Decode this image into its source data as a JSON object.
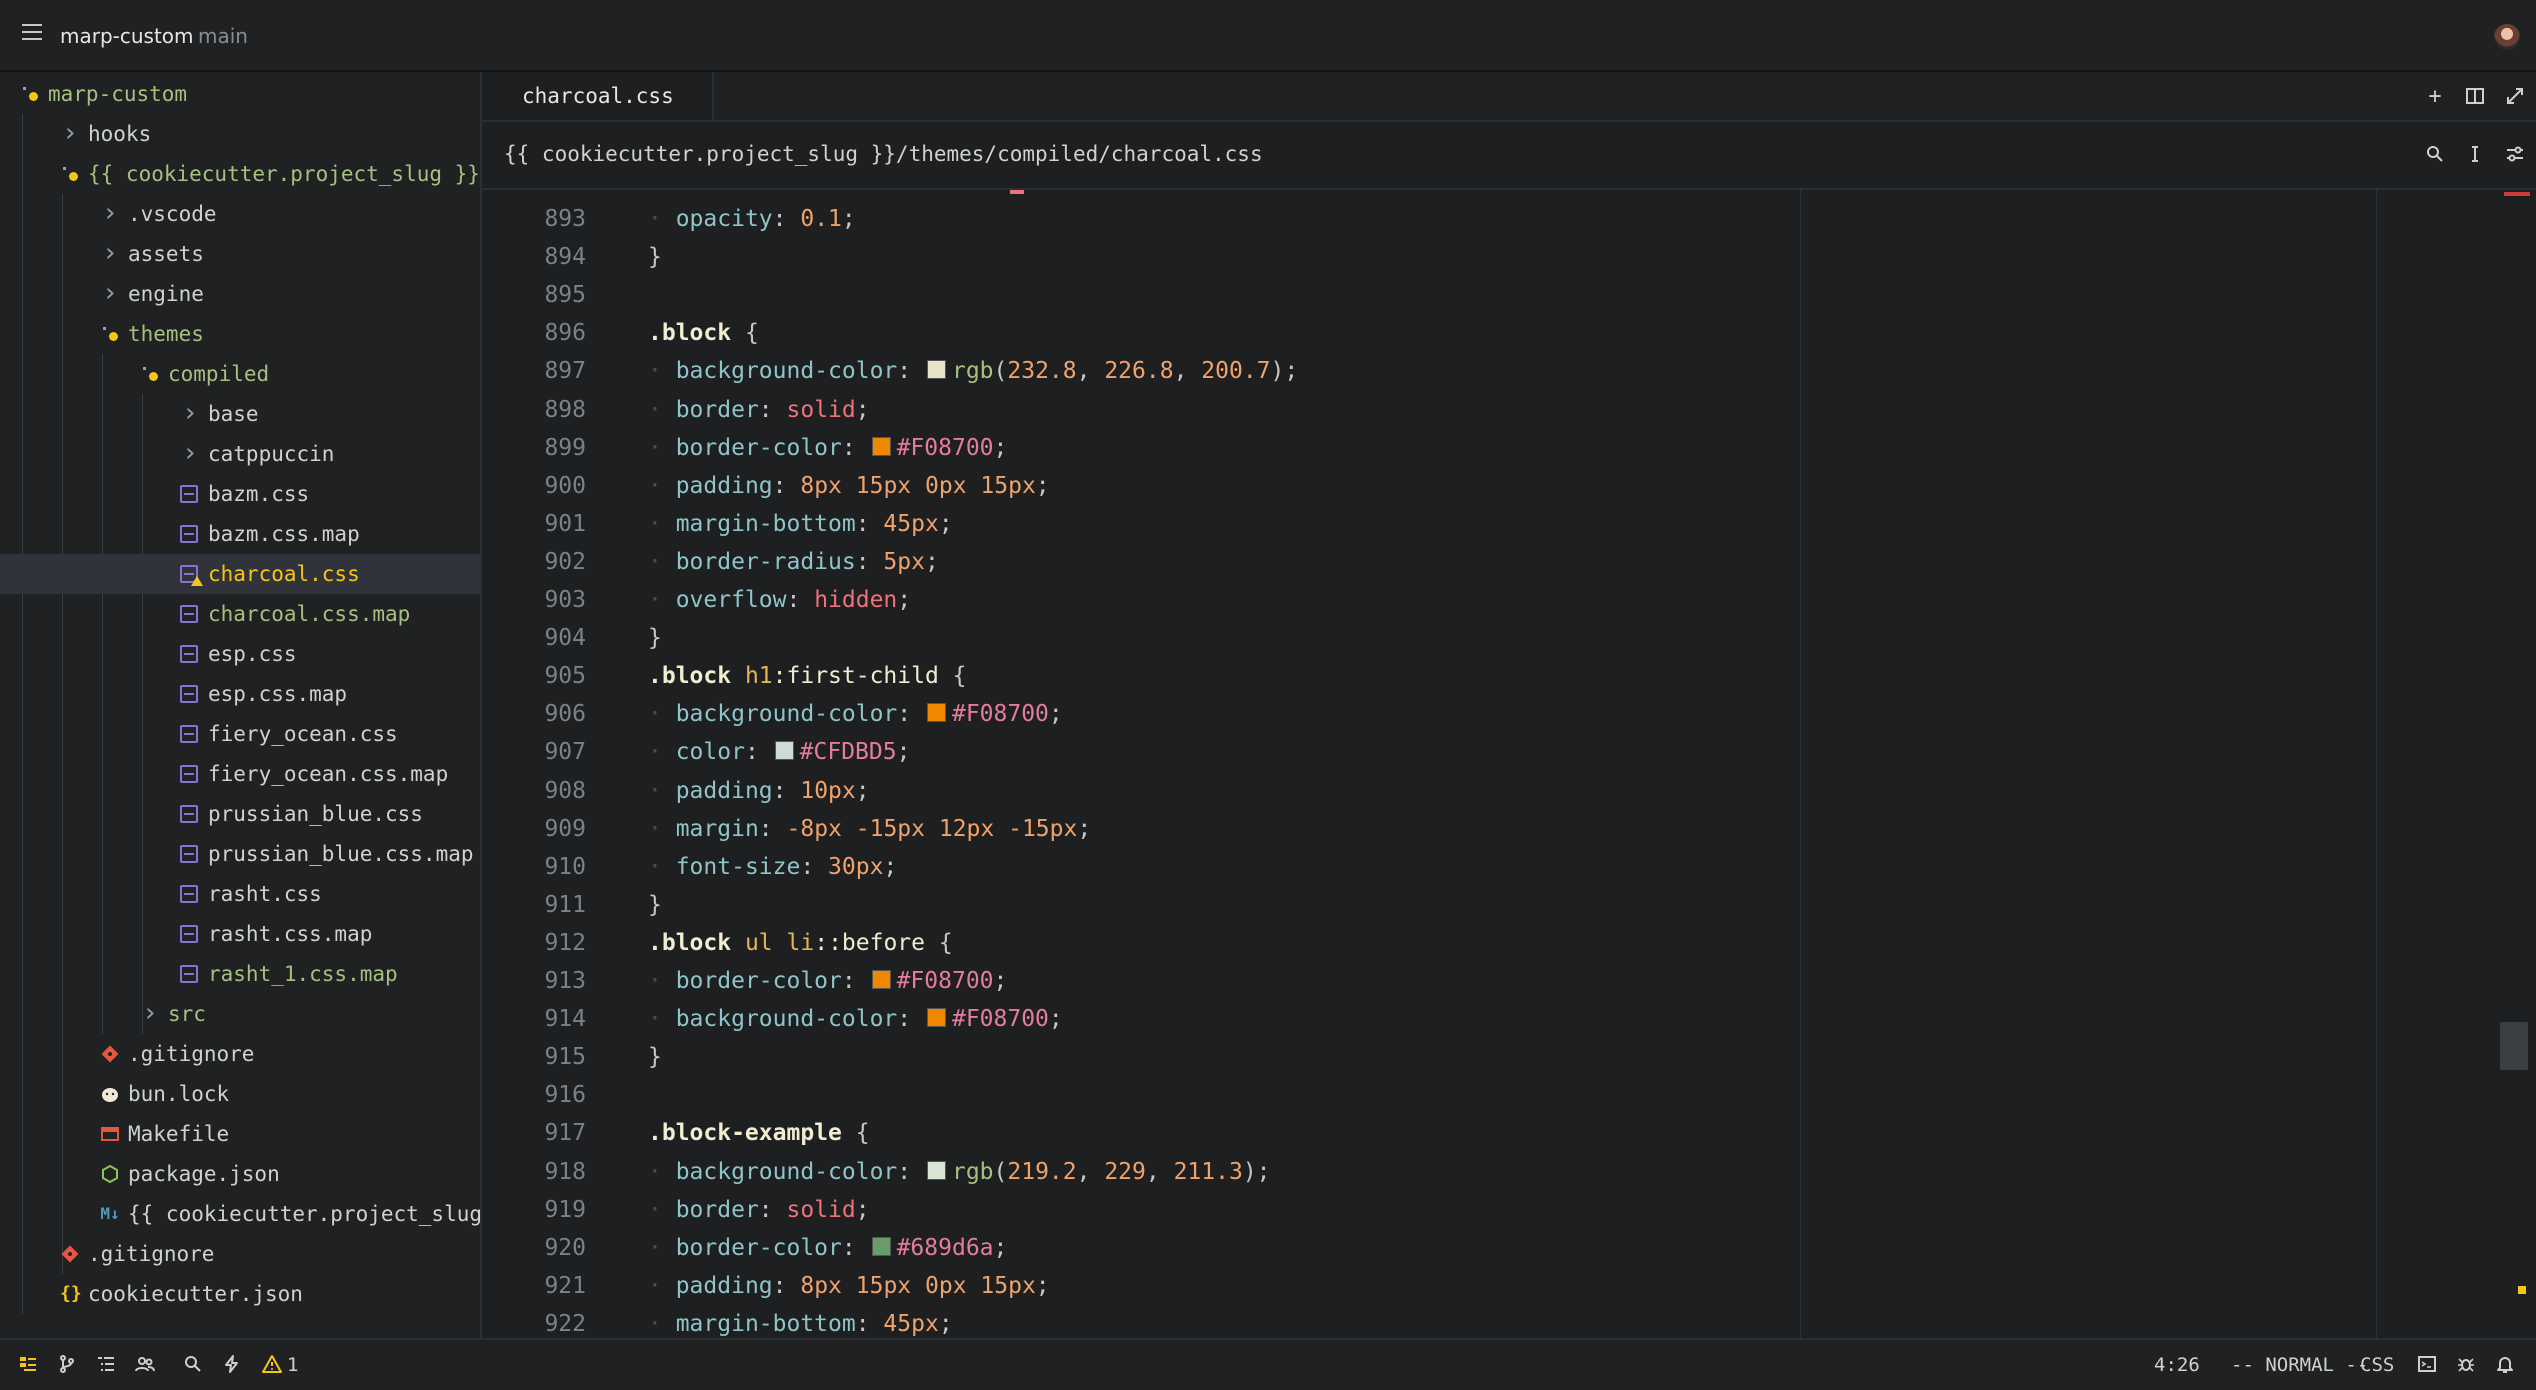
{
  "titlebar": {
    "project": "marp-custom",
    "branch": "main"
  },
  "sidebar": {
    "items": [
      {
        "label": "marp-custom",
        "kind": "folder-open-modified",
        "depth": 0,
        "color": "#a7c080"
      },
      {
        "label": "hooks",
        "kind": "folder",
        "depth": 1,
        "color": "#cfd1d2"
      },
      {
        "label": "{{ cookiecutter.project_slug }}",
        "kind": "folder-open-modified",
        "depth": 1,
        "color": "#a7c080"
      },
      {
        "label": ".vscode",
        "kind": "folder",
        "depth": 2,
        "color": "#cfd1d2"
      },
      {
        "label": "assets",
        "kind": "folder",
        "depth": 2,
        "color": "#cfd1d2"
      },
      {
        "label": "engine",
        "kind": "folder",
        "depth": 2,
        "color": "#cfd1d2"
      },
      {
        "label": "themes",
        "kind": "folder-open-modified",
        "depth": 2,
        "color": "#a7c080"
      },
      {
        "label": "compiled",
        "kind": "folder-open-modified",
        "depth": 3,
        "color": "#a7c080"
      },
      {
        "label": "base",
        "kind": "folder",
        "depth": 4,
        "color": "#cfd1d2"
      },
      {
        "label": "catppuccin",
        "kind": "folder",
        "depth": 4,
        "color": "#cfd1d2"
      },
      {
        "label": "bazm.css",
        "kind": "css",
        "depth": 4,
        "color": "#cfd1d2"
      },
      {
        "label": "bazm.css.map",
        "kind": "css",
        "depth": 4,
        "color": "#cfd1d2"
      },
      {
        "label": "charcoal.css",
        "kind": "css-warn",
        "depth": 4,
        "color": "#f5c518",
        "selected": true
      },
      {
        "label": "charcoal.css.map",
        "kind": "css",
        "depth": 4,
        "color": "#a7c080"
      },
      {
        "label": "esp.css",
        "kind": "css",
        "depth": 4,
        "color": "#cfd1d2"
      },
      {
        "label": "esp.css.map",
        "kind": "css",
        "depth": 4,
        "color": "#cfd1d2"
      },
      {
        "label": "fiery_ocean.css",
        "kind": "css",
        "depth": 4,
        "color": "#cfd1d2"
      },
      {
        "label": "fiery_ocean.css.map",
        "kind": "css",
        "depth": 4,
        "color": "#cfd1d2"
      },
      {
        "label": "prussian_blue.css",
        "kind": "css",
        "depth": 4,
        "color": "#cfd1d2"
      },
      {
        "label": "prussian_blue.css.map",
        "kind": "css",
        "depth": 4,
        "color": "#cfd1d2"
      },
      {
        "label": "rasht.css",
        "kind": "css",
        "depth": 4,
        "color": "#cfd1d2"
      },
      {
        "label": "rasht.css.map",
        "kind": "css",
        "depth": 4,
        "color": "#cfd1d2"
      },
      {
        "label": "rasht_1.css.map",
        "kind": "css",
        "depth": 4,
        "color": "#a7c080"
      },
      {
        "label": "src",
        "kind": "folder",
        "depth": 3,
        "color": "#a7c080"
      },
      {
        "label": ".gitignore",
        "kind": "git",
        "depth": 2,
        "color": "#cfd1d2"
      },
      {
        "label": "bun.lock",
        "kind": "bun",
        "depth": 2,
        "color": "#cfd1d2"
      },
      {
        "label": "Makefile",
        "kind": "make",
        "depth": 2,
        "color": "#cfd1d2"
      },
      {
        "label": "package.json",
        "kind": "node",
        "depth": 2,
        "color": "#cfd1d2"
      },
      {
        "label": "{{ cookiecutter.project_slug",
        "kind": "md",
        "depth": 2,
        "color": "#cfd1d2"
      },
      {
        "label": ".gitignore",
        "kind": "git",
        "depth": 1,
        "color": "#cfd1d2"
      },
      {
        "label": "cookiecutter.json",
        "kind": "json",
        "depth": 1,
        "color": "#cfd1d2"
      }
    ]
  },
  "editor": {
    "tab_label": "charcoal.css",
    "breadcrumb": "{{ cookiecutter.project_slug }}/themes/compiled/charcoal.css",
    "lines": [
      {
        "n": "893",
        "tokens": [
          [
            "i",
            "  "
          ],
          [
            "prop",
            "opacity"
          ],
          [
            "punc",
            ": "
          ],
          [
            "num",
            "0.1"
          ],
          [
            "punc",
            ";"
          ]
        ]
      },
      {
        "n": "894",
        "tokens": [
          [
            "punc",
            "}"
          ]
        ]
      },
      {
        "n": "895",
        "tokens": []
      },
      {
        "n": "896",
        "tokens": [
          [
            "sel",
            ".block"
          ],
          [
            "punc",
            " {"
          ]
        ]
      },
      {
        "n": "897",
        "tokens": [
          [
            "i",
            "  "
          ],
          [
            "prop",
            "background-color"
          ],
          [
            "punc",
            ": "
          ],
          [
            "sw",
            "#e8e2c8"
          ],
          [
            "fn",
            "rgb"
          ],
          [
            "punc",
            "("
          ],
          [
            "num",
            "232.8"
          ],
          [
            "punc",
            ", "
          ],
          [
            "num",
            "226.8"
          ],
          [
            "punc",
            ", "
          ],
          [
            "num",
            "200.7"
          ],
          [
            "punc",
            ");"
          ]
        ]
      },
      {
        "n": "898",
        "tokens": [
          [
            "i",
            "  "
          ],
          [
            "prop",
            "border"
          ],
          [
            "punc",
            ": "
          ],
          [
            "val",
            "solid"
          ],
          [
            "punc",
            ";"
          ]
        ]
      },
      {
        "n": "899",
        "tokens": [
          [
            "i",
            "  "
          ],
          [
            "prop",
            "border-color"
          ],
          [
            "punc",
            ": "
          ],
          [
            "sw",
            "#F08700"
          ],
          [
            "hex",
            "#F08700"
          ],
          [
            "punc",
            ";"
          ]
        ]
      },
      {
        "n": "900",
        "tokens": [
          [
            "i",
            "  "
          ],
          [
            "prop",
            "padding"
          ],
          [
            "punc",
            ": "
          ],
          [
            "num",
            "8px"
          ],
          [
            "punc",
            " "
          ],
          [
            "num",
            "15px"
          ],
          [
            "punc",
            " "
          ],
          [
            "num",
            "0px"
          ],
          [
            "punc",
            " "
          ],
          [
            "num",
            "15px"
          ],
          [
            "punc",
            ";"
          ]
        ]
      },
      {
        "n": "901",
        "tokens": [
          [
            "i",
            "  "
          ],
          [
            "prop",
            "margin-bottom"
          ],
          [
            "punc",
            ": "
          ],
          [
            "num",
            "45px"
          ],
          [
            "punc",
            ";"
          ]
        ]
      },
      {
        "n": "902",
        "tokens": [
          [
            "i",
            "  "
          ],
          [
            "prop",
            "border-radius"
          ],
          [
            "punc",
            ": "
          ],
          [
            "num",
            "5px"
          ],
          [
            "punc",
            ";"
          ]
        ]
      },
      {
        "n": "903",
        "tokens": [
          [
            "i",
            "  "
          ],
          [
            "prop",
            "overflow"
          ],
          [
            "punc",
            ": "
          ],
          [
            "val",
            "hidden"
          ],
          [
            "punc",
            ";"
          ]
        ]
      },
      {
        "n": "904",
        "tokens": [
          [
            "punc",
            "}"
          ]
        ]
      },
      {
        "n": "905",
        "tokens": [
          [
            "sel",
            ".block"
          ],
          [
            "punc",
            " "
          ],
          [
            "tag",
            "h1"
          ],
          [
            "pcl",
            ":first-child"
          ],
          [
            "punc",
            " {"
          ]
        ]
      },
      {
        "n": "906",
        "tokens": [
          [
            "i",
            "  "
          ],
          [
            "prop",
            "background-color"
          ],
          [
            "punc",
            ": "
          ],
          [
            "sw",
            "#F08700"
          ],
          [
            "hex",
            "#F08700"
          ],
          [
            "punc",
            ";"
          ]
        ]
      },
      {
        "n": "907",
        "tokens": [
          [
            "i",
            "  "
          ],
          [
            "prop",
            "color"
          ],
          [
            "punc",
            ": "
          ],
          [
            "sw",
            "#CFDBD5"
          ],
          [
            "hex",
            "#CFDBD5"
          ],
          [
            "punc",
            ";"
          ]
        ]
      },
      {
        "n": "908",
        "tokens": [
          [
            "i",
            "  "
          ],
          [
            "prop",
            "padding"
          ],
          [
            "punc",
            ": "
          ],
          [
            "num",
            "10px"
          ],
          [
            "punc",
            ";"
          ]
        ]
      },
      {
        "n": "909",
        "tokens": [
          [
            "i",
            "  "
          ],
          [
            "prop",
            "margin"
          ],
          [
            "punc",
            ": "
          ],
          [
            "num",
            "-8px"
          ],
          [
            "punc",
            " "
          ],
          [
            "num",
            "-15px"
          ],
          [
            "punc",
            " "
          ],
          [
            "num",
            "12px"
          ],
          [
            "punc",
            " "
          ],
          [
            "num",
            "-15px"
          ],
          [
            "punc",
            ";"
          ]
        ]
      },
      {
        "n": "910",
        "tokens": [
          [
            "i",
            "  "
          ],
          [
            "prop",
            "font-size"
          ],
          [
            "punc",
            ": "
          ],
          [
            "num",
            "30px"
          ],
          [
            "punc",
            ";"
          ]
        ]
      },
      {
        "n": "911",
        "tokens": [
          [
            "punc",
            "}"
          ]
        ]
      },
      {
        "n": "912",
        "tokens": [
          [
            "sel",
            ".block"
          ],
          [
            "punc",
            " "
          ],
          [
            "tag",
            "ul"
          ],
          [
            "punc",
            " "
          ],
          [
            "tag",
            "li"
          ],
          [
            "pcl",
            "::before"
          ],
          [
            "punc",
            " {"
          ]
        ]
      },
      {
        "n": "913",
        "tokens": [
          [
            "i",
            "  "
          ],
          [
            "prop",
            "border-color"
          ],
          [
            "punc",
            ": "
          ],
          [
            "sw",
            "#F08700"
          ],
          [
            "hex",
            "#F08700"
          ],
          [
            "punc",
            ";"
          ]
        ]
      },
      {
        "n": "914",
        "tokens": [
          [
            "i",
            "  "
          ],
          [
            "prop",
            "background-color"
          ],
          [
            "punc",
            ": "
          ],
          [
            "sw",
            "#F08700"
          ],
          [
            "hex",
            "#F08700"
          ],
          [
            "punc",
            ";"
          ]
        ]
      },
      {
        "n": "915",
        "tokens": [
          [
            "punc",
            "}"
          ]
        ]
      },
      {
        "n": "916",
        "tokens": []
      },
      {
        "n": "917",
        "tokens": [
          [
            "sel",
            ".block-example"
          ],
          [
            "punc",
            " {"
          ]
        ]
      },
      {
        "n": "918",
        "tokens": [
          [
            "i",
            "  "
          ],
          [
            "prop",
            "background-color"
          ],
          [
            "punc",
            ": "
          ],
          [
            "sw",
            "#dbe5d3"
          ],
          [
            "fn",
            "rgb"
          ],
          [
            "punc",
            "("
          ],
          [
            "num",
            "219.2"
          ],
          [
            "punc",
            ", "
          ],
          [
            "num",
            "229"
          ],
          [
            "punc",
            ", "
          ],
          [
            "num",
            "211.3"
          ],
          [
            "punc",
            ");"
          ]
        ]
      },
      {
        "n": "919",
        "tokens": [
          [
            "i",
            "  "
          ],
          [
            "prop",
            "border"
          ],
          [
            "punc",
            ": "
          ],
          [
            "val",
            "solid"
          ],
          [
            "punc",
            ";"
          ]
        ]
      },
      {
        "n": "920",
        "tokens": [
          [
            "i",
            "  "
          ],
          [
            "prop",
            "border-color"
          ],
          [
            "punc",
            ": "
          ],
          [
            "sw",
            "#689d6a"
          ],
          [
            "hex",
            "#689d6a"
          ],
          [
            "punc",
            ";"
          ]
        ]
      },
      {
        "n": "921",
        "tokens": [
          [
            "i",
            "  "
          ],
          [
            "prop",
            "padding"
          ],
          [
            "punc",
            ": "
          ],
          [
            "num",
            "8px"
          ],
          [
            "punc",
            " "
          ],
          [
            "num",
            "15px"
          ],
          [
            "punc",
            " "
          ],
          [
            "num",
            "0px"
          ],
          [
            "punc",
            " "
          ],
          [
            "num",
            "15px"
          ],
          [
            "punc",
            ";"
          ]
        ]
      },
      {
        "n": "922",
        "tokens": [
          [
            "i",
            "  "
          ],
          [
            "prop",
            "margin-bottom"
          ],
          [
            "punc",
            ": "
          ],
          [
            "num",
            "45px"
          ],
          [
            "punc",
            ";"
          ]
        ]
      }
    ]
  },
  "statusbar": {
    "warning_count": "1",
    "cursor": "4:26",
    "mode": "-- NORMAL --",
    "language": "CSS"
  }
}
